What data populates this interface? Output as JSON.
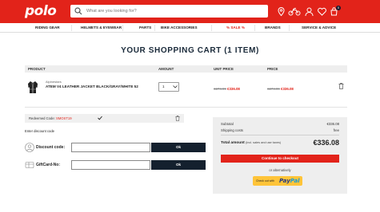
{
  "header": {
    "logo": "polo",
    "search_placeholder": "What are you looking for?",
    "cart_count": "0",
    "icons": [
      "search-icon",
      "location-pin-icon",
      "motorcycle-icon",
      "user-icon",
      "heart-icon",
      "cart-icon"
    ]
  },
  "nav": {
    "items": [
      "RIDING GEAR",
      "HELMETS & EYEWEAR",
      "PARTS",
      "BIKE ACCESSORIES",
      "% SALE %",
      "BRANDS",
      "SERVICE & ADVICE"
    ]
  },
  "page": {
    "title": "YOUR SHOPPING CART (1 ITEM)"
  },
  "table": {
    "headers": {
      "product": "PRODUCT",
      "amount": "AMOUNT",
      "unit_price": "UNIT PRICE",
      "price": "PRICE"
    }
  },
  "item": {
    "brand": "Alpinestars",
    "name": "ATEM V4 LEATHER JACKET BLACK/GRAY/WHITE 52",
    "quantity": "1",
    "unit_old": "€274.99",
    "unit_new": "€336.08",
    "price_old": "€274.99",
    "price_new": "€336.08"
  },
  "coupon": {
    "label": "Redeemed Code:",
    "code": "SMOST19",
    "enter_label": "Enter discount code",
    "discount_label": "Discount code:",
    "giftcard_label": "GiftCard-No:",
    "ok_label": "Ok"
  },
  "summary": {
    "subtotal_label": "Subtotal",
    "subtotal_value": "€336.08",
    "shipping_label": "Shipping costs",
    "shipping_value": "free",
    "total_label": "Total amount",
    "total_note": "(incl. sales and use taxes)",
    "total_value": "€336.08",
    "checkout_label": "Continue to checkout",
    "alt_label": "or alternatively",
    "paypal_prefix": "Check out with",
    "paypal_a": "Pay",
    "paypal_b": "Pal"
  },
  "colors": {
    "brand_red": "#e2231a",
    "dark_button": "#14202e",
    "paypal_yellow": "#ffc439"
  }
}
